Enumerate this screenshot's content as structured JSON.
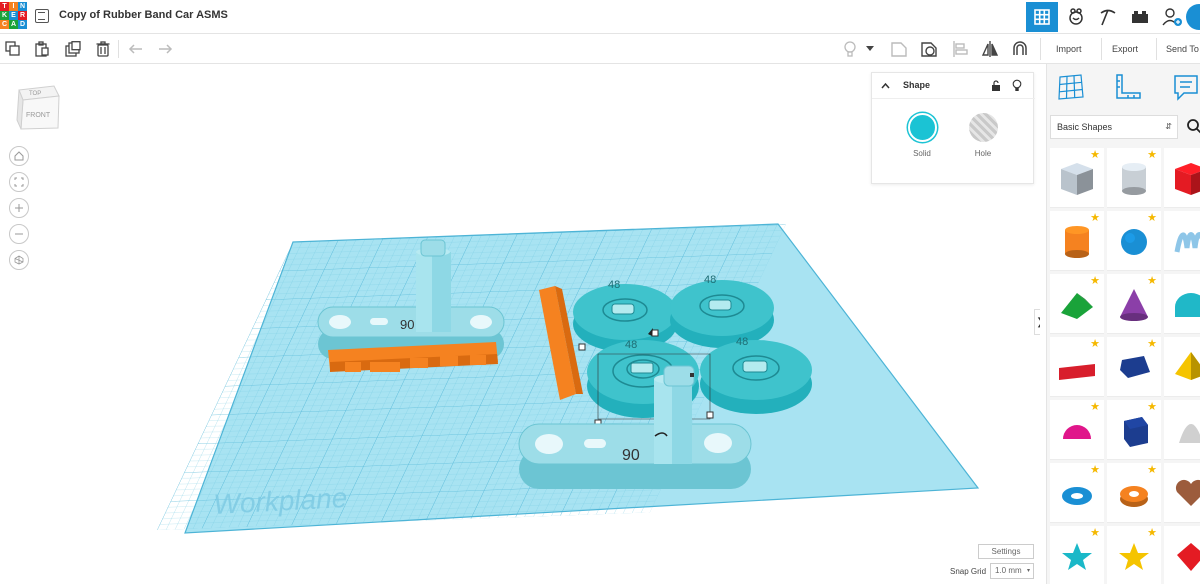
{
  "app": {
    "logo_letters": [
      "T",
      "I",
      "N",
      "K",
      "E",
      "R",
      "C",
      "A",
      "D"
    ],
    "document_title": "Copy of Rubber Band Car ASMS"
  },
  "topbar": {
    "icons": [
      "grid-view-icon",
      "blocks-editor-icon",
      "pickaxe-icon",
      "bricks-icon",
      "add-user-icon",
      "profile-avatar"
    ]
  },
  "toolbar": {
    "left_tools": [
      "copy-icon",
      "paste-icon",
      "duplicate-icon",
      "delete-icon",
      "undo-icon",
      "redo-icon"
    ],
    "right_tools": [
      "note-bulb-icon",
      "dropdown-caret-icon",
      "show-all-icon",
      "hide-icon",
      "align-icon",
      "mirror-icon",
      "group-magnet-icon"
    ],
    "import_label": "Import",
    "export_label": "Export",
    "send_to_label": "Send To"
  },
  "view_cube": {
    "top_label": "TOP",
    "front_label": "FRONT"
  },
  "nav_controls": [
    "home-view-icon",
    "fit-view-icon",
    "zoom-in-icon",
    "zoom-out-icon",
    "perspective-icon"
  ],
  "shape_panel": {
    "title": "Shape",
    "solid_label": "Solid",
    "hole_label": "Hole",
    "solid_color": "#1bc3d4",
    "hole_color": "#c9c9c9"
  },
  "workplane": {
    "label": "Workplane",
    "color": "#9fdff0"
  },
  "scene": {
    "axle_label_1": "90",
    "axle_label_2": "90",
    "wheel_labels": [
      "48",
      "48",
      "48",
      "48"
    ],
    "part_color": "#8edbe8",
    "wheel_color": "#3fc3cc",
    "orange_color": "#f58220"
  },
  "bottom": {
    "settings_label": "Settings",
    "snap_grid_label": "Snap Grid",
    "snap_grid_value": "1.0 mm"
  },
  "right_panel": {
    "top_icons": [
      "workplane-grid-icon",
      "ruler-icon",
      "notes-icon"
    ],
    "library": "Basic Shapes",
    "shapes": [
      {
        "name": "box-hole",
        "color": "#b9c3cc"
      },
      {
        "name": "cylinder-hole",
        "color": "#c8cfd5"
      },
      {
        "name": "box",
        "color": "#e41b23"
      },
      {
        "name": "cylinder",
        "color": "#f58220"
      },
      {
        "name": "sphere",
        "color": "#1a8fd4"
      },
      {
        "name": "scribble",
        "color": "#8ec6e8"
      },
      {
        "name": "roof",
        "color": "#1aa33a"
      },
      {
        "name": "cone",
        "color": "#8b3fa8"
      },
      {
        "name": "round-roof",
        "color": "#20b8c8"
      },
      {
        "name": "text",
        "color": "#d81e2c"
      },
      {
        "name": "polygon",
        "color": "#1c3d8f"
      },
      {
        "name": "pyramid",
        "color": "#f5c400"
      },
      {
        "name": "half-sphere",
        "color": "#e0168a"
      },
      {
        "name": "hexagonal-prism",
        "color": "#1c3d8f"
      },
      {
        "name": "paraboloid",
        "color": "#d0d0d0"
      },
      {
        "name": "torus",
        "color": "#1a8fd4"
      },
      {
        "name": "tube",
        "color": "#f58220"
      },
      {
        "name": "heart",
        "color": "#9c5c3c"
      },
      {
        "name": "star",
        "color": "#1ab8c8"
      },
      {
        "name": "star-gold",
        "color": "#f5c400"
      },
      {
        "name": "gem",
        "color": "#e41b23"
      }
    ]
  }
}
